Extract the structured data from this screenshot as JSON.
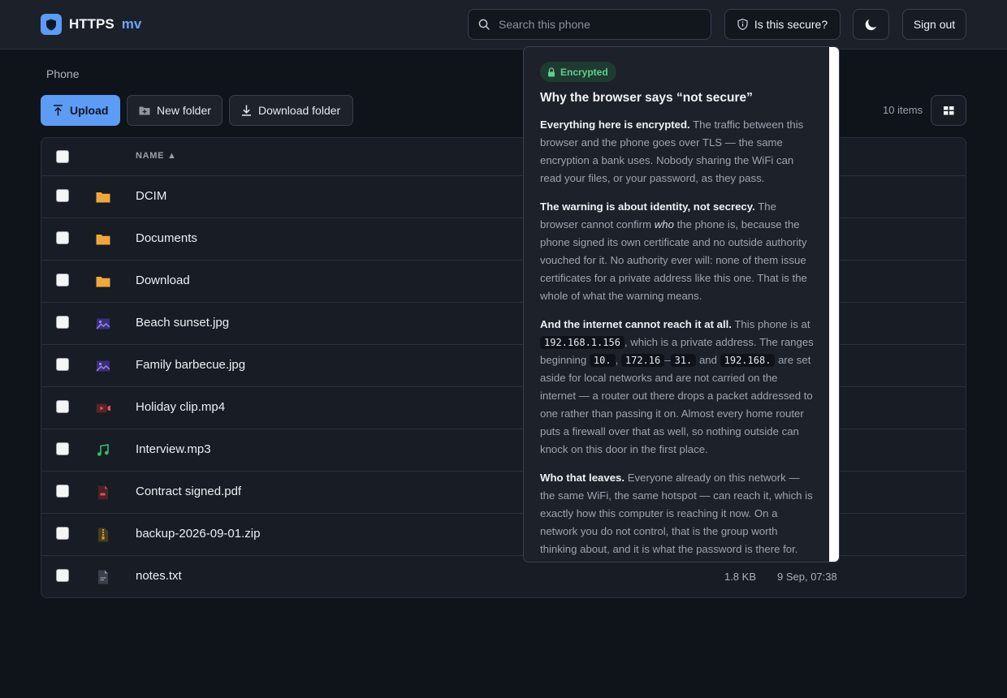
{
  "header": {
    "brand_name": "HTTPS",
    "brand_sub": "mv",
    "search_placeholder": "Search this phone",
    "secure_label": "Is this secure?",
    "signout_label": "Sign out"
  },
  "breadcrumb": "Phone",
  "toolbar": {
    "upload_label": "Upload",
    "new_folder_label": "New folder",
    "download_folder_label": "Download folder",
    "item_count": "10 items"
  },
  "table": {
    "name_header": "NAME ▲",
    "rows": [
      {
        "name": "DCIM",
        "icon": "folder-icon",
        "size": "",
        "date": ""
      },
      {
        "name": "Documents",
        "icon": "folder-icon",
        "size": "",
        "date": ""
      },
      {
        "name": "Download",
        "icon": "folder-icon",
        "size": "",
        "date": ""
      },
      {
        "name": "Beach sunset.jpg",
        "icon": "image-file-icon",
        "size": "",
        "date": ""
      },
      {
        "name": "Family barbecue.jpg",
        "icon": "image-file-icon",
        "size": "",
        "date": ""
      },
      {
        "name": "Holiday clip.mp4",
        "icon": "video-file-icon",
        "size": "",
        "date": ""
      },
      {
        "name": "Interview.mp3",
        "icon": "audio-file-icon",
        "size": "",
        "date": ""
      },
      {
        "name": "Contract signed.pdf",
        "icon": "pdf-file-icon",
        "size": "",
        "date": ""
      },
      {
        "name": "backup-2026-09-01.zip",
        "icon": "zip-file-icon",
        "size": "",
        "date": ""
      },
      {
        "name": "notes.txt",
        "icon": "text-file-icon",
        "size": "1.8 KB",
        "date": "9 Sep, 07:38"
      }
    ]
  },
  "popover": {
    "badge": "Encrypted",
    "title": "Why the browser says “not secure”",
    "p1_bold": "Everything here is encrypted.",
    "p1_text": " The traffic between this browser and the phone goes over TLS — the same encryption a bank uses. Nobody sharing the WiFi can read your files, or your password, as they pass.",
    "p2_bold": "The warning is about identity, not secrecy.",
    "p2_text_a": " The browser cannot confirm ",
    "p2_italic": "who",
    "p2_text_b": " the phone is, because the phone signed its own certificate and no outside authority vouched for it. No authority ever will: none of them issue certificates for a private address like this one. That is the whole of what the warning means.",
    "p3_bold": "And the internet cannot reach it at all.",
    "p3_text_a": " This phone is at ",
    "p3_ip": "192.168.1.156",
    "p3_text_b": ", which is a private address. The ranges beginning ",
    "p3_r1": "10.",
    "p3_sep1": ", ",
    "p3_r2": "172.16",
    "p3_sep2": "–",
    "p3_r3": "31.",
    "p3_sep3": " and ",
    "p3_r4": "192.168.",
    "p3_text_c": " are set aside for local networks and are not carried on the internet — a router out there drops a packet addressed to one rather than passing it on. Almost every home router puts a firewall over that as well, so nothing outside can knock on this door in the first place.",
    "p4_bold": "Who that leaves.",
    "p4_text": " Everyone already on this network — the same WiFi, the same hotspot — can reach it, which is exactly how this computer is reaching it now. On a network you do not control, that is the group worth thinking about, and it is what the password is there for."
  },
  "colors": {
    "accent": "#5d9cf5",
    "folder": "#f0a73a",
    "image": "#7c5ce6",
    "video": "#d04a4a",
    "audio": "#2fbf71",
    "pdf": "#c0504d",
    "zip": "#c9a13a",
    "encrypted": "#5fcf8e"
  }
}
